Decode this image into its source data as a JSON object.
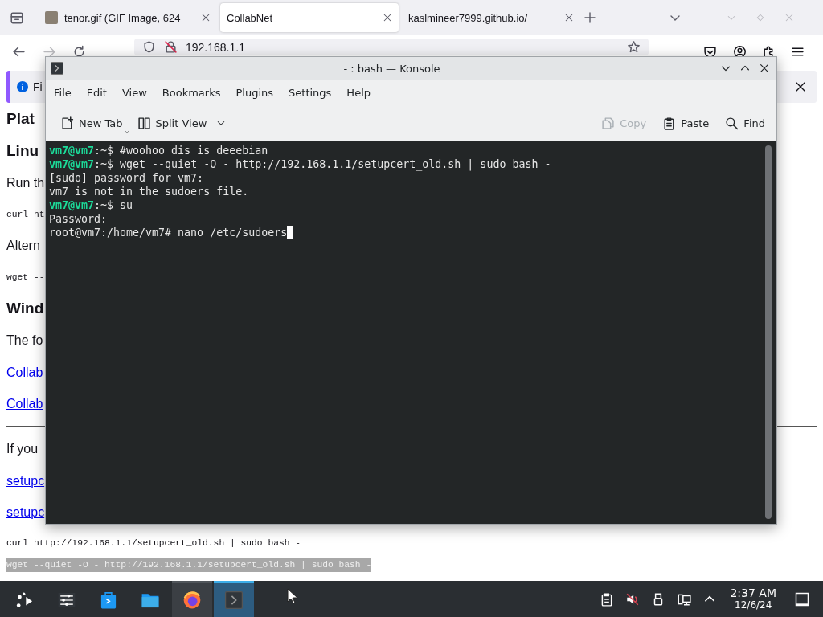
{
  "browser": {
    "tabs": [
      {
        "label": "tenor.gif (GIF Image, 624",
        "selected": false,
        "has_favicon": true
      },
      {
        "label": "CollabNet",
        "selected": true,
        "has_favicon": false
      },
      {
        "label": "kaslmineer7999.github.io/",
        "selected": false,
        "has_favicon": false
      }
    ],
    "address": "192.168.1.1",
    "notification": {
      "text": "Fi"
    },
    "page": [
      {
        "kind": "heading",
        "text": "Plat"
      },
      {
        "kind": "heading",
        "text": "Linu"
      },
      {
        "kind": "text",
        "text": "Run th"
      },
      {
        "kind": "code",
        "text": "curl ht"
      },
      {
        "kind": "text",
        "text": "Altern"
      },
      {
        "kind": "code",
        "text": "wget --"
      },
      {
        "kind": "heading",
        "text": "Wind"
      },
      {
        "kind": "text",
        "text": "The fo"
      },
      {
        "kind": "link",
        "text": "Collab"
      },
      {
        "kind": "link",
        "text": "Collab"
      },
      {
        "kind": "rule"
      },
      {
        "kind": "text",
        "text": "If you"
      },
      {
        "kind": "link",
        "text": "setupc"
      },
      {
        "kind": "link",
        "text": "setupc"
      },
      {
        "kind": "code",
        "text": "curl http://192.168.1.1/setupcert_old.sh | sudo bash -",
        "selected": false
      },
      {
        "kind": "code",
        "text": "wget --quiet -O - http://192.168.1.1/setupcert_old.sh | sudo bash -",
        "selected": true
      }
    ]
  },
  "konsole": {
    "title": "- : bash — Konsole",
    "menu": [
      "File",
      "Edit",
      "View",
      "Bookmarks",
      "Plugins",
      "Settings",
      "Help"
    ],
    "toolbar": [
      {
        "kind": "new-tab",
        "label": "New Tab",
        "disabled": false,
        "has_menu": true
      },
      {
        "kind": "split-view",
        "label": "Split View",
        "disabled": false,
        "has_menu": true
      },
      {
        "kind": "copy",
        "label": "Copy",
        "disabled": true,
        "has_menu": false
      },
      {
        "kind": "paste",
        "label": "Paste",
        "disabled": false,
        "has_menu": false
      },
      {
        "kind": "find",
        "label": "Find",
        "disabled": false,
        "has_menu": false
      }
    ],
    "lines": [
      {
        "prompt": "vm7@vm7",
        "text": ":~$ #woohoo dis is deeebian"
      },
      {
        "prompt": "vm7@vm7",
        "text": ":~$ wget --quiet -O - http://192.168.1.1/setupcert_old.sh | sudo bash -"
      },
      {
        "text": "[sudo] password for vm7:"
      },
      {
        "text": "vm7 is not in the sudoers file."
      },
      {
        "prompt": "vm7@vm7",
        "text": ":~$ su"
      },
      {
        "text": "Password:"
      },
      {
        "text": "root@vm7:/home/vm7# nano /etc/sudoers"
      }
    ],
    "cursor": true
  },
  "taskbar": {
    "apps": [
      {
        "kind": "launcher",
        "running": false,
        "selected": false
      },
      {
        "kind": "settings",
        "running": false,
        "selected": false
      },
      {
        "kind": "store",
        "running": false,
        "selected": false
      },
      {
        "kind": "files",
        "running": false,
        "selected": false
      },
      {
        "kind": "browser",
        "running": true,
        "selected": false
      },
      {
        "kind": "terminal",
        "running": true,
        "selected": true
      }
    ],
    "tray": [
      {
        "kind": "clipboard"
      },
      {
        "kind": "volume-muted"
      },
      {
        "kind": "usb"
      },
      {
        "kind": "network"
      },
      {
        "kind": "expand"
      }
    ],
    "time": "2:37 AM",
    "date": "12/6/24"
  }
}
